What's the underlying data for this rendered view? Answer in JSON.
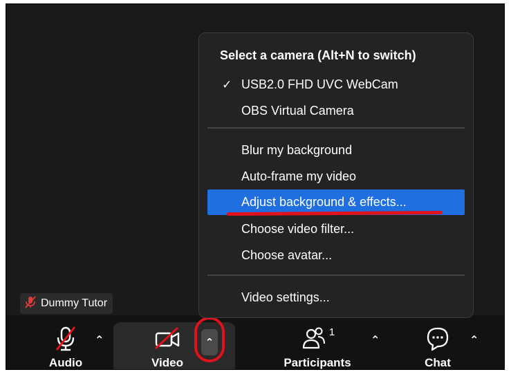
{
  "participant": {
    "name": "Dummy Tutor"
  },
  "camera_menu": {
    "header": "Select a camera (Alt+N to switch)",
    "cameras": [
      {
        "label": "USB2.0 FHD UVC WebCam",
        "checked": true
      },
      {
        "label": "OBS Virtual Camera",
        "checked": false
      }
    ],
    "checkmark": "✓",
    "effects": [
      {
        "label": "Blur my background"
      },
      {
        "label": "Auto-frame my video"
      },
      {
        "label": "Adjust background & effects...",
        "highlighted": true
      },
      {
        "label": "Choose video filter..."
      },
      {
        "label": "Choose avatar..."
      }
    ],
    "settings": {
      "label": "Video settings..."
    }
  },
  "toolbar": {
    "audio": {
      "label": "Audio",
      "icon": "mic-muted-icon"
    },
    "video": {
      "label": "Video",
      "icon": "camera-off-icon"
    },
    "participants": {
      "label": "Participants",
      "count": "1",
      "icon": "participants-icon"
    },
    "chat": {
      "label": "Chat",
      "icon": "chat-icon"
    },
    "caret": "⌃"
  },
  "colors": {
    "highlight": "#1f6fe0",
    "annotation_red": "#e0121c",
    "menu_bg": "#232323",
    "toolbar_bg": "#121212"
  }
}
